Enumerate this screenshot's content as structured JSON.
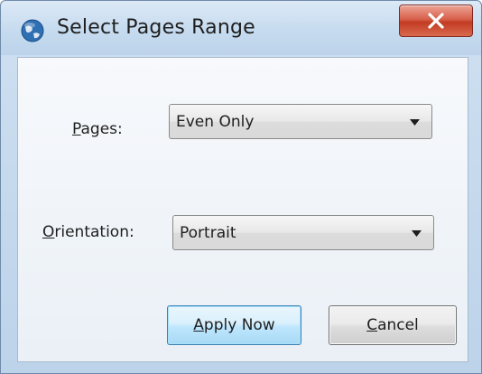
{
  "window": {
    "title": "Select Pages Range",
    "close_icon": "close-x-icon",
    "app_icon": "globe-app-icon"
  },
  "form": {
    "pages": {
      "label_mnemonic": "P",
      "label_rest": "ages:",
      "selected": "Even Only"
    },
    "orientation": {
      "label_mnemonic": "O",
      "label_rest": "rientation:",
      "selected": "Portrait"
    }
  },
  "buttons": {
    "apply": {
      "mnemonic": "A",
      "rest": "pply Now"
    },
    "cancel": {
      "mnemonic": "C",
      "rest": "ancel"
    }
  },
  "colors": {
    "close_button": "#c23b22",
    "default_button_border": "#3c7fb1"
  }
}
